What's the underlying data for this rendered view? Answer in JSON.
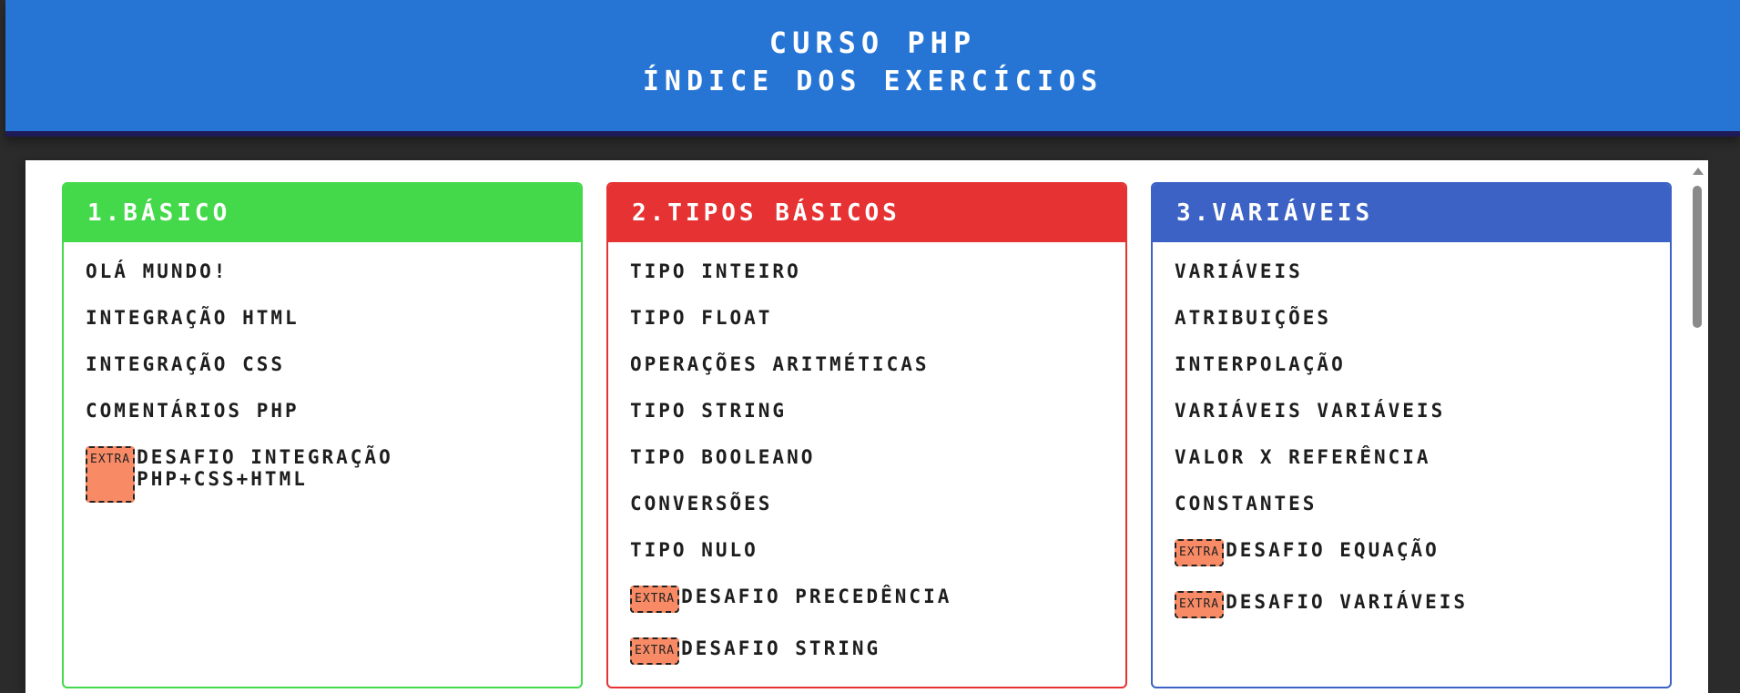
{
  "header": {
    "title": "Curso PHP",
    "subtitle": "Índice dos Exercícios"
  },
  "sections": [
    {
      "title": "1.Básico",
      "color": "#44d94a",
      "items": [
        {
          "label": "Olá Mundo!"
        },
        {
          "label": "Integração HTML"
        },
        {
          "label": "Integração CSS"
        },
        {
          "label": "Comentários PHP"
        },
        {
          "label": "Desafio Integração PHP+CSS+HTML",
          "badge": "EXTRA"
        }
      ]
    },
    {
      "title": "2.Tipos Básicos",
      "color": "#e63232",
      "items": [
        {
          "label": "Tipo Inteiro"
        },
        {
          "label": "Tipo Float"
        },
        {
          "label": "Operações Aritméticas"
        },
        {
          "label": "Tipo String"
        },
        {
          "label": "Tipo Booleano"
        },
        {
          "label": "Conversões"
        },
        {
          "label": "Tipo Nulo"
        },
        {
          "label": "Desafio Precedência",
          "badge": "EXTRA"
        },
        {
          "label": "Desafio String",
          "badge": "EXTRA"
        }
      ]
    },
    {
      "title": "3.Variáveis",
      "color": "#3b62c4",
      "items": [
        {
          "label": "Variáveis"
        },
        {
          "label": "Atribuições"
        },
        {
          "label": "Interpolação"
        },
        {
          "label": "Variáveis Variáveis"
        },
        {
          "label": "Valor x Referência"
        },
        {
          "label": "Constantes"
        },
        {
          "label": "Desafio Equação",
          "badge": "EXTRA"
        },
        {
          "label": "Desafio Variáveis",
          "badge": "EXTRA"
        }
      ]
    }
  ],
  "scrollbar": {
    "up_icon": "chevron-up-icon"
  }
}
